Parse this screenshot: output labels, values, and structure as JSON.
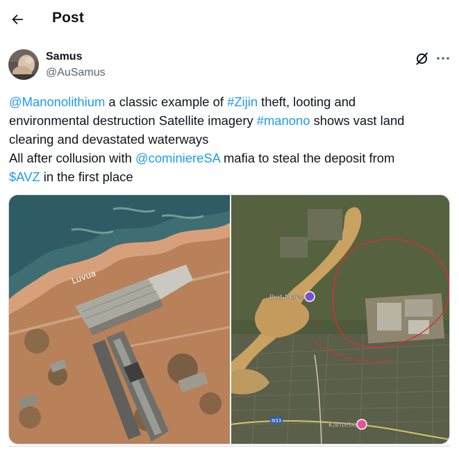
{
  "header": {
    "title": "Post"
  },
  "author": {
    "name": "Samus",
    "handle": "@AuSamus"
  },
  "post": {
    "line1": {
      "mention": "@Manonolithium",
      "t1": " a classic example of ",
      "hashtag": "#Zijin",
      "t2": " theft, looting and"
    },
    "line2": {
      "t1": "environmental destruction Satellite imagery ",
      "hashtag": "#manono",
      "t2": " shows vast land"
    },
    "line3": {
      "t1": "clearing and devastated waterways"
    },
    "line4": {
      "t1": "All after collusion with ",
      "mention": "@cominiereSA",
      "t2": " mafia to steal the deposit from"
    },
    "line5": {
      "cashtag": "$AVZ",
      "t1": " in the first place"
    }
  },
  "media": {
    "left_photo": {
      "label": "Luvua"
    },
    "right_photo": {
      "place_label": "Puit Marec",
      "town_label": "Kanteba",
      "road_label": "N33"
    }
  },
  "colors": {
    "link": "#1d9bf0",
    "text": "#0f1419",
    "secondary": "#536471"
  },
  "icons": [
    "back-arrow-icon",
    "grok-icon",
    "more-icon"
  ]
}
